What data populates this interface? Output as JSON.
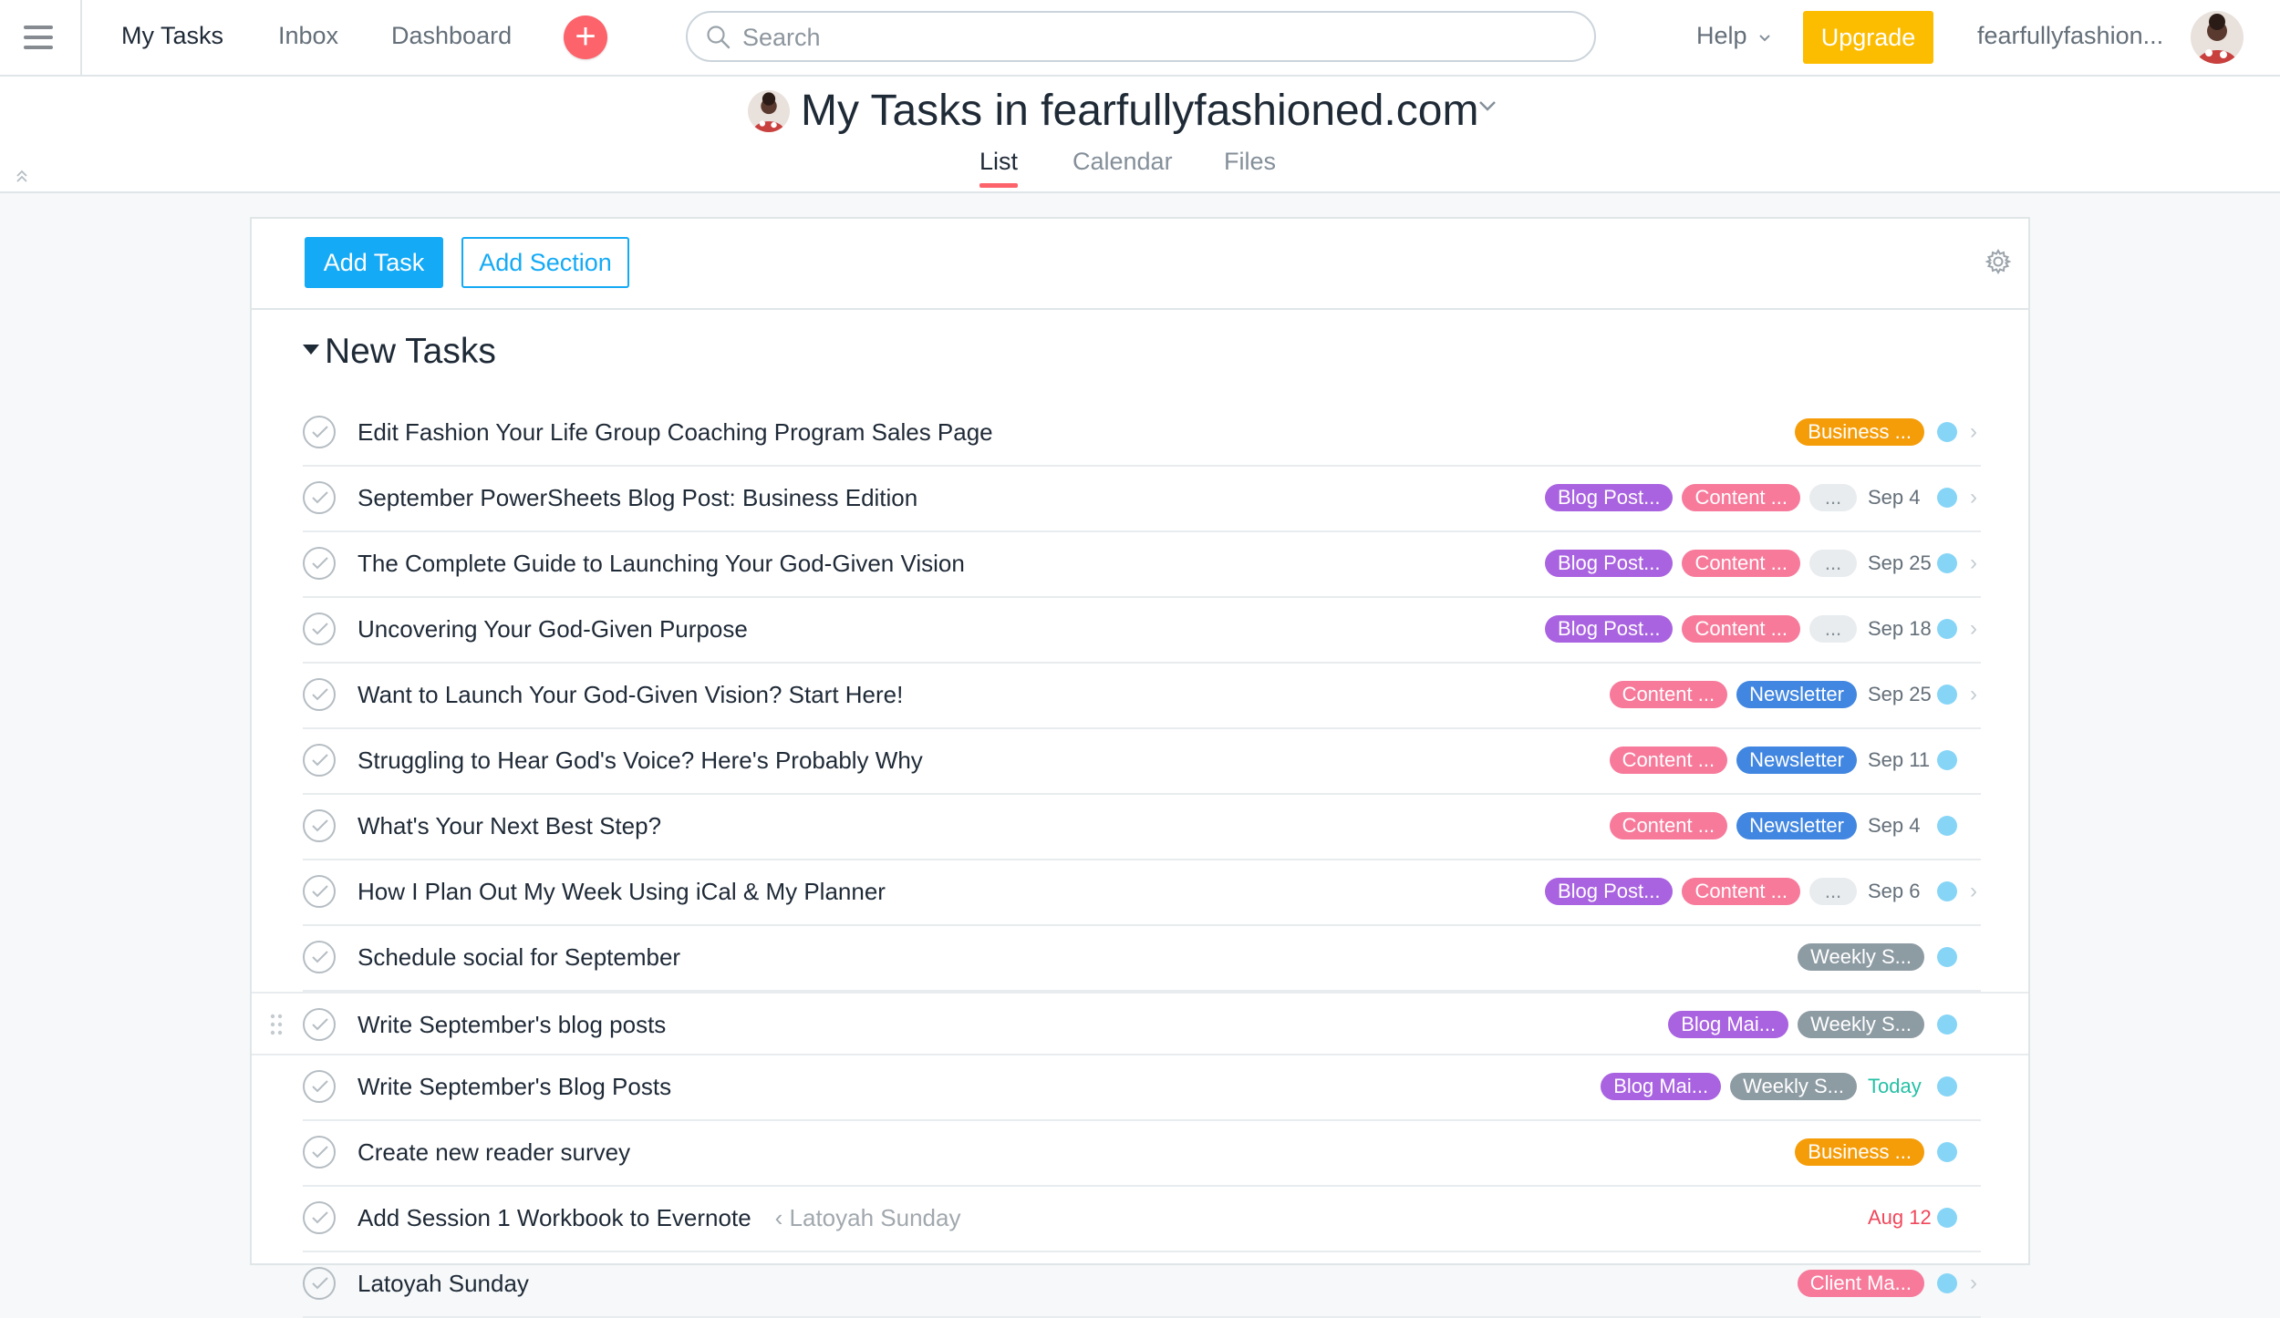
{
  "topbar": {
    "nav": [
      "My Tasks",
      "Inbox",
      "Dashboard"
    ],
    "search_placeholder": "Search",
    "help": "Help",
    "upgrade": "Upgrade",
    "username": "fearfullyfashion..."
  },
  "project": {
    "title": "My Tasks in fearfullyfashioned.com",
    "tabs": [
      "List",
      "Calendar",
      "Files"
    ]
  },
  "toolbar": {
    "add_task": "Add Task",
    "add_section": "Add Section"
  },
  "section": {
    "title": "New Tasks"
  },
  "colors": {
    "orange": "#f59d09",
    "purple": "#a962e0",
    "pink": "#f77a9b",
    "blue": "#4186e0",
    "gray": "#8d9ba3"
  },
  "tasks": [
    {
      "title": "Edit Fashion Your Life Group Coaching Program Sales Page",
      "tags": [
        {
          "label": "Business ...",
          "color": "orange"
        }
      ],
      "due": "",
      "more": false,
      "chevron": true
    },
    {
      "title": "September PowerSheets Blog Post: Business Edition",
      "tags": [
        {
          "label": "Blog Post...",
          "color": "purple"
        },
        {
          "label": "Content ...",
          "color": "pink"
        }
      ],
      "due": "Sep 4",
      "more": true,
      "chevron": true
    },
    {
      "title": "The Complete Guide to Launching Your God-Given Vision",
      "tags": [
        {
          "label": "Blog Post...",
          "color": "purple"
        },
        {
          "label": "Content ...",
          "color": "pink"
        }
      ],
      "due": "Sep 25",
      "more": true,
      "chevron": true
    },
    {
      "title": "Uncovering Your God-Given Purpose",
      "tags": [
        {
          "label": "Blog Post...",
          "color": "purple"
        },
        {
          "label": "Content ...",
          "color": "pink"
        }
      ],
      "due": "Sep 18",
      "more": true,
      "chevron": true
    },
    {
      "title": "Want to Launch Your God-Given Vision? Start Here!",
      "tags": [
        {
          "label": "Content ...",
          "color": "pink"
        },
        {
          "label": "Newsletter",
          "color": "blue"
        }
      ],
      "due": "Sep 25",
      "more": false,
      "chevron": true
    },
    {
      "title": "Struggling to Hear God's Voice? Here's Probably Why",
      "tags": [
        {
          "label": "Content ...",
          "color": "pink"
        },
        {
          "label": "Newsletter",
          "color": "blue"
        }
      ],
      "due": "Sep 11",
      "more": false,
      "chevron": false
    },
    {
      "title": "What's Your Next Best Step?",
      "tags": [
        {
          "label": "Content ...",
          "color": "pink"
        },
        {
          "label": "Newsletter",
          "color": "blue"
        }
      ],
      "due": "Sep 4",
      "more": false,
      "chevron": false
    },
    {
      "title": "How I Plan Out My Week Using iCal & My Planner",
      "tags": [
        {
          "label": "Blog Post...",
          "color": "purple"
        },
        {
          "label": "Content ...",
          "color": "pink"
        }
      ],
      "due": "Sep 6",
      "more": true,
      "chevron": true
    },
    {
      "title": "Schedule social for September",
      "tags": [
        {
          "label": "Weekly S...",
          "color": "gray"
        }
      ],
      "due": "",
      "more": false,
      "chevron": false
    },
    {
      "title": "Write September's blog posts",
      "tags": [
        {
          "label": "Blog Mai...",
          "color": "purple"
        },
        {
          "label": "Weekly S...",
          "color": "gray"
        }
      ],
      "due": "",
      "more": false,
      "chevron": false,
      "hover": true
    },
    {
      "title": "Write September's Blog Posts",
      "tags": [
        {
          "label": "Blog Mai...",
          "color": "purple"
        },
        {
          "label": "Weekly S...",
          "color": "gray"
        }
      ],
      "due": "Today",
      "due_style": "today",
      "more": false,
      "chevron": false
    },
    {
      "title": "Create new reader survey",
      "tags": [
        {
          "label": "Business ...",
          "color": "orange"
        }
      ],
      "due": "",
      "more": false,
      "chevron": false
    },
    {
      "title": "Add Session 1 Workbook to Evernote",
      "parent": "‹ Latoyah Sunday",
      "tags": [],
      "due": "Aug 12",
      "due_style": "overdue",
      "more": false,
      "chevron": false
    },
    {
      "title": "Latoyah Sunday",
      "tags": [
        {
          "label": "Client Ma...",
          "color": "pink"
        }
      ],
      "due": "",
      "more": false,
      "chevron": true
    }
  ]
}
